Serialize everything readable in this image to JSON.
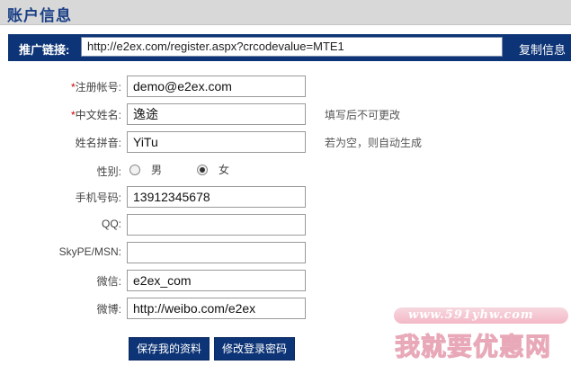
{
  "header": {
    "title": "账户信息"
  },
  "promo": {
    "label": "推广链接:",
    "url": "http://e2ex.com/register.aspx?crcodevalue=MTE1",
    "copy_label": "复制信息"
  },
  "form": {
    "account": {
      "required_mark": "*",
      "label": "注册帐号:",
      "value": "demo@e2ex.com"
    },
    "chinese_name": {
      "required_mark": "*",
      "label": "中文姓名:",
      "value": "逸途",
      "hint": "填写后不可更改"
    },
    "pinyin_name": {
      "label": "姓名拼音:",
      "value": "YiTu",
      "hint": "若为空，则自动生成"
    },
    "gender": {
      "label": "性别:",
      "options": [
        "男",
        "女"
      ],
      "selected": "女"
    },
    "mobile": {
      "label": "手机号码:",
      "value": "13912345678"
    },
    "qq": {
      "label": "QQ:",
      "value": ""
    },
    "skype": {
      "label": "SkyPE/MSN:",
      "value": ""
    },
    "wechat": {
      "label": "微信:",
      "value": "e2ex_com"
    },
    "weibo": {
      "label": "微博:",
      "value": "http://weibo.com/e2ex"
    }
  },
  "buttons": {
    "save": "保存我的资料",
    "change_password": "修改登录密码"
  },
  "watermark": {
    "url": "www.591yhw.com",
    "text": "我就要优惠网"
  },
  "colors": {
    "navy": "#0d3476",
    "title_blue": "#1a3f86",
    "required_red": "#cc0000"
  }
}
